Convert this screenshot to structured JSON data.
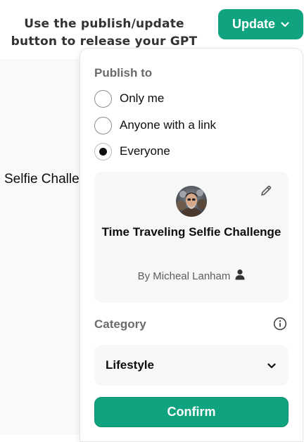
{
  "annotation": {
    "line1": "Use the publish/update",
    "line2": "button to release your GPT"
  },
  "header": {
    "update_label": "Update",
    "update_icon": "chevron-down-icon"
  },
  "background_page": {
    "title_fragment": "Selfie Challe"
  },
  "publish": {
    "label": "Publish to",
    "options": [
      {
        "label": "Only me",
        "selected": false
      },
      {
        "label": "Anyone with a link",
        "selected": false
      },
      {
        "label": "Everyone",
        "selected": true
      }
    ]
  },
  "gpt_card": {
    "name": "Time Traveling Selfie Challenge",
    "author": "By Micheal Lanham",
    "author_icon": "person-icon",
    "edit_icon": "pencil-icon"
  },
  "category": {
    "label": "Category",
    "info_icon": "info-icon",
    "selected": "Lifestyle",
    "select_icon": "chevron-down-icon"
  },
  "confirm": {
    "label": "Confirm"
  },
  "colors": {
    "accent": "#10a37f",
    "muted_text": "#6b6b6b",
    "card_bg": "#f7f7f7"
  }
}
